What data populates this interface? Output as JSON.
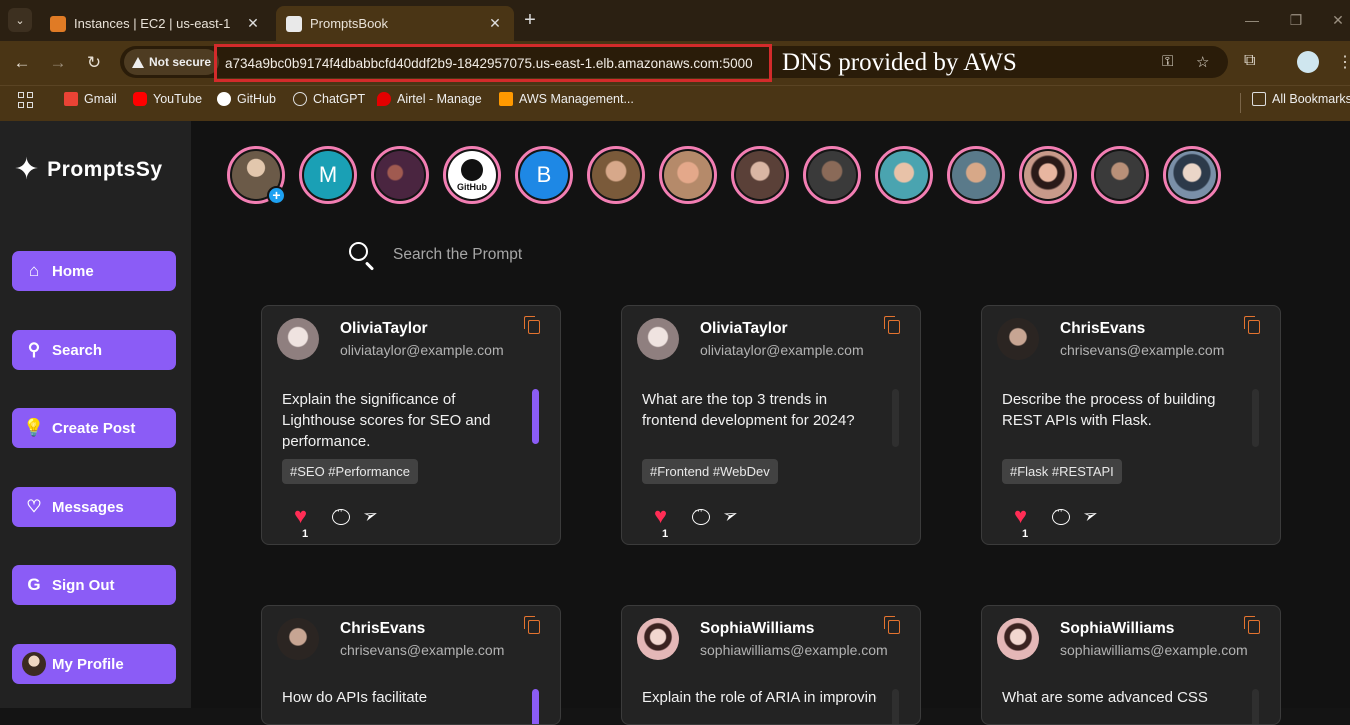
{
  "browser": {
    "tabs": [
      {
        "title": "Instances | EC2 | us-east-1",
        "active": false,
        "favicon_color": "#e07b25"
      },
      {
        "title": "PromptsBook",
        "active": true,
        "favicon_color": "#e9e9e9"
      }
    ],
    "security_label": "Not secure",
    "url": "a734a9bc0b9174f4dbabbcfd40ddf2b9-1842957075.us-east-1.elb.amazonaws.com:5000",
    "annotation": "DNS provided by AWS",
    "bookmarks": [
      {
        "label": "Gmail",
        "icon": "gmail-icon",
        "color": "#ea4335"
      },
      {
        "label": "YouTube",
        "icon": "youtube-icon",
        "color": "#ff0000"
      },
      {
        "label": "GitHub",
        "icon": "github-icon",
        "color": "#ffffff"
      },
      {
        "label": "ChatGPT",
        "icon": "chatgpt-icon",
        "color": "#dddddd"
      },
      {
        "label": "Airtel - Manage",
        "icon": "airtel-icon",
        "color": "#e40000"
      },
      {
        "label": "AWS Management...",
        "icon": "aws-icon",
        "color": "#ff9900"
      }
    ],
    "all_bookmarks": "All Bookmarks"
  },
  "app": {
    "brand": "PromptsSy",
    "accent": "#8b5cf6",
    "nav": [
      {
        "label": "Home",
        "icon": "home-icon"
      },
      {
        "label": "Search",
        "icon": "search-icon"
      },
      {
        "label": "Create Post",
        "icon": "lightbulb-icon"
      },
      {
        "label": "Messages",
        "icon": "heart-message-icon"
      },
      {
        "label": "Sign Out",
        "icon": "sign-out-icon"
      },
      {
        "label": "My Profile",
        "icon": "profile-avatar-icon"
      }
    ],
    "stories": [
      {
        "kind": "photo",
        "color": "#6b5a48"
      },
      {
        "kind": "letter",
        "letter": "M",
        "color": "#1aa0b5"
      },
      {
        "kind": "photo",
        "color": "#4a2540"
      },
      {
        "kind": "github",
        "color": "#ffffff"
      },
      {
        "kind": "letter",
        "letter": "B",
        "color": "#1e88e5"
      },
      {
        "kind": "photo",
        "color": "#7a5a3a"
      },
      {
        "kind": "photo",
        "color": "#b58a6a"
      },
      {
        "kind": "photo",
        "color": "#5a4038"
      },
      {
        "kind": "photo",
        "color": "#3a3a3a"
      },
      {
        "kind": "photo",
        "color": "#4aa4b0"
      },
      {
        "kind": "photo",
        "color": "#5a7a8a"
      },
      {
        "kind": "photo",
        "color": "#c89a8a"
      },
      {
        "kind": "photo",
        "color": "#3a3a3a"
      },
      {
        "kind": "photo",
        "color": "#7a90a8"
      }
    ],
    "search_placeholder": "Search the Prompt",
    "heart_color": "#ff2d55",
    "cards": [
      {
        "user": "OliviaTaylor",
        "email": "oliviataylor@example.com",
        "avatar_color": "#d7c9c9",
        "prompt": "Explain the significance of Lighthouse scores for SEO and performance.",
        "tags": "#SEO #Performance",
        "likes": "1",
        "scroll_active": true
      },
      {
        "user": "OliviaTaylor",
        "email": "oliviataylor@example.com",
        "avatar_color": "#d7c9c9",
        "prompt": "What are the top 3 trends in frontend development for 2024?",
        "tags": "#Frontend #WebDev",
        "likes": "1",
        "scroll_active": false
      },
      {
        "user": "ChrisEvans",
        "email": "chrisevans@example.com",
        "avatar_color": "#3a3330",
        "prompt": "Describe the process of building REST APIs with Flask.",
        "tags": "#Flask #RESTAPI",
        "likes": "1",
        "scroll_active": false
      },
      {
        "user": "ChrisEvans",
        "email": "chrisevans@example.com",
        "avatar_color": "#3a3330",
        "prompt": "How do APIs facilitate",
        "scroll_active": true
      },
      {
        "user": "SophiaWilliams",
        "email": "sophiawilliams@example.com",
        "avatar_color": "#e4b7b7",
        "prompt": "Explain the role of ARIA in improving",
        "scroll_active": false
      },
      {
        "user": "SophiaWilliams",
        "email": "sophiawilliams@example.com",
        "avatar_color": "#e4b7b7",
        "prompt": "What are some advanced CSS",
        "scroll_active": false
      }
    ]
  }
}
